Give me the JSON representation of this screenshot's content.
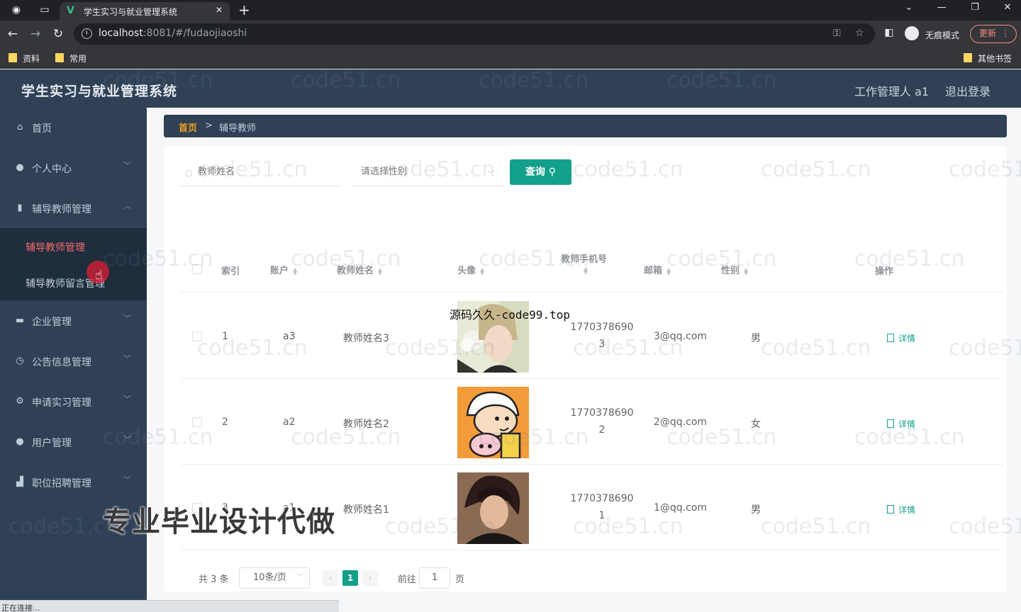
{
  "browser": {
    "tab_title": "学生实习与就业管理系统",
    "url_host": "localhost",
    "url_rest": ":8081/#/fudaojiaoshi",
    "incognito_label": "无痕模式",
    "update_label": "更新",
    "bookmarks": [
      "资料",
      "常用"
    ],
    "other_bookmarks": "其他书签",
    "status_text": "正在连接..."
  },
  "header": {
    "title": "学生实习与就业管理系统",
    "user": "工作管理人 a1",
    "logout": "退出登录"
  },
  "sidebar": {
    "items": [
      {
        "label": "首页",
        "icon": "home-icon"
      },
      {
        "label": "个人中心",
        "icon": "user-icon"
      },
      {
        "label": "辅导教师管理",
        "icon": "chart-icon"
      },
      {
        "label": "企业管理",
        "icon": "briefcase-icon"
      },
      {
        "label": "公告信息管理",
        "icon": "clock-icon"
      },
      {
        "label": "申请实习管理",
        "icon": "settings-icon"
      },
      {
        "label": "用户管理",
        "icon": "user-icon"
      },
      {
        "label": "职位招聘管理",
        "icon": "thumb-icon"
      }
    ],
    "submenu": [
      {
        "label": "辅导教师管理",
        "active": true
      },
      {
        "label": "辅导教师留言管理",
        "active": false
      }
    ]
  },
  "breadcrumb": {
    "home": "首页",
    "sep": ">",
    "current": "辅导教师"
  },
  "search": {
    "name_placeholder": "教师姓名",
    "gender_placeholder": "请选择性别",
    "query_label": "查询"
  },
  "table": {
    "headers": [
      "索引",
      "账户",
      "教师姓名",
      "头像",
      "教师手机号",
      "邮箱",
      "性别",
      "操作"
    ],
    "rows": [
      {
        "index": "1",
        "account": "a3",
        "name": "教师姓名3",
        "phone_1": "1770378690",
        "phone_2": "3",
        "email": "3@qq.com",
        "gender": "男",
        "action": "详情"
      },
      {
        "index": "2",
        "account": "a2",
        "name": "教师姓名2",
        "phone_1": "1770378690",
        "phone_2": "2",
        "email": "2@qq.com",
        "gender": "女",
        "action": "详情"
      },
      {
        "index": "3",
        "account": "a1",
        "name": "教师姓名1",
        "phone_1": "1770378690",
        "phone_2": "1",
        "email": "1@qq.com",
        "gender": "男",
        "action": "详情"
      }
    ]
  },
  "pagination": {
    "total": "共 3 条",
    "page_size": "10条/页",
    "current_page": "1",
    "goto": "前往",
    "jump_value": "1",
    "page_suffix": "页"
  },
  "overlays": {
    "watermark": "code51.cn",
    "source_url": "源码久久-code99.top",
    "promo": "专业毕业设计代做"
  },
  "colors": {
    "sidebar_bg": "#304156",
    "accent": "#13a08a",
    "active_menu": "#f56c6c",
    "breadcrumb_home": "#f0a020"
  }
}
